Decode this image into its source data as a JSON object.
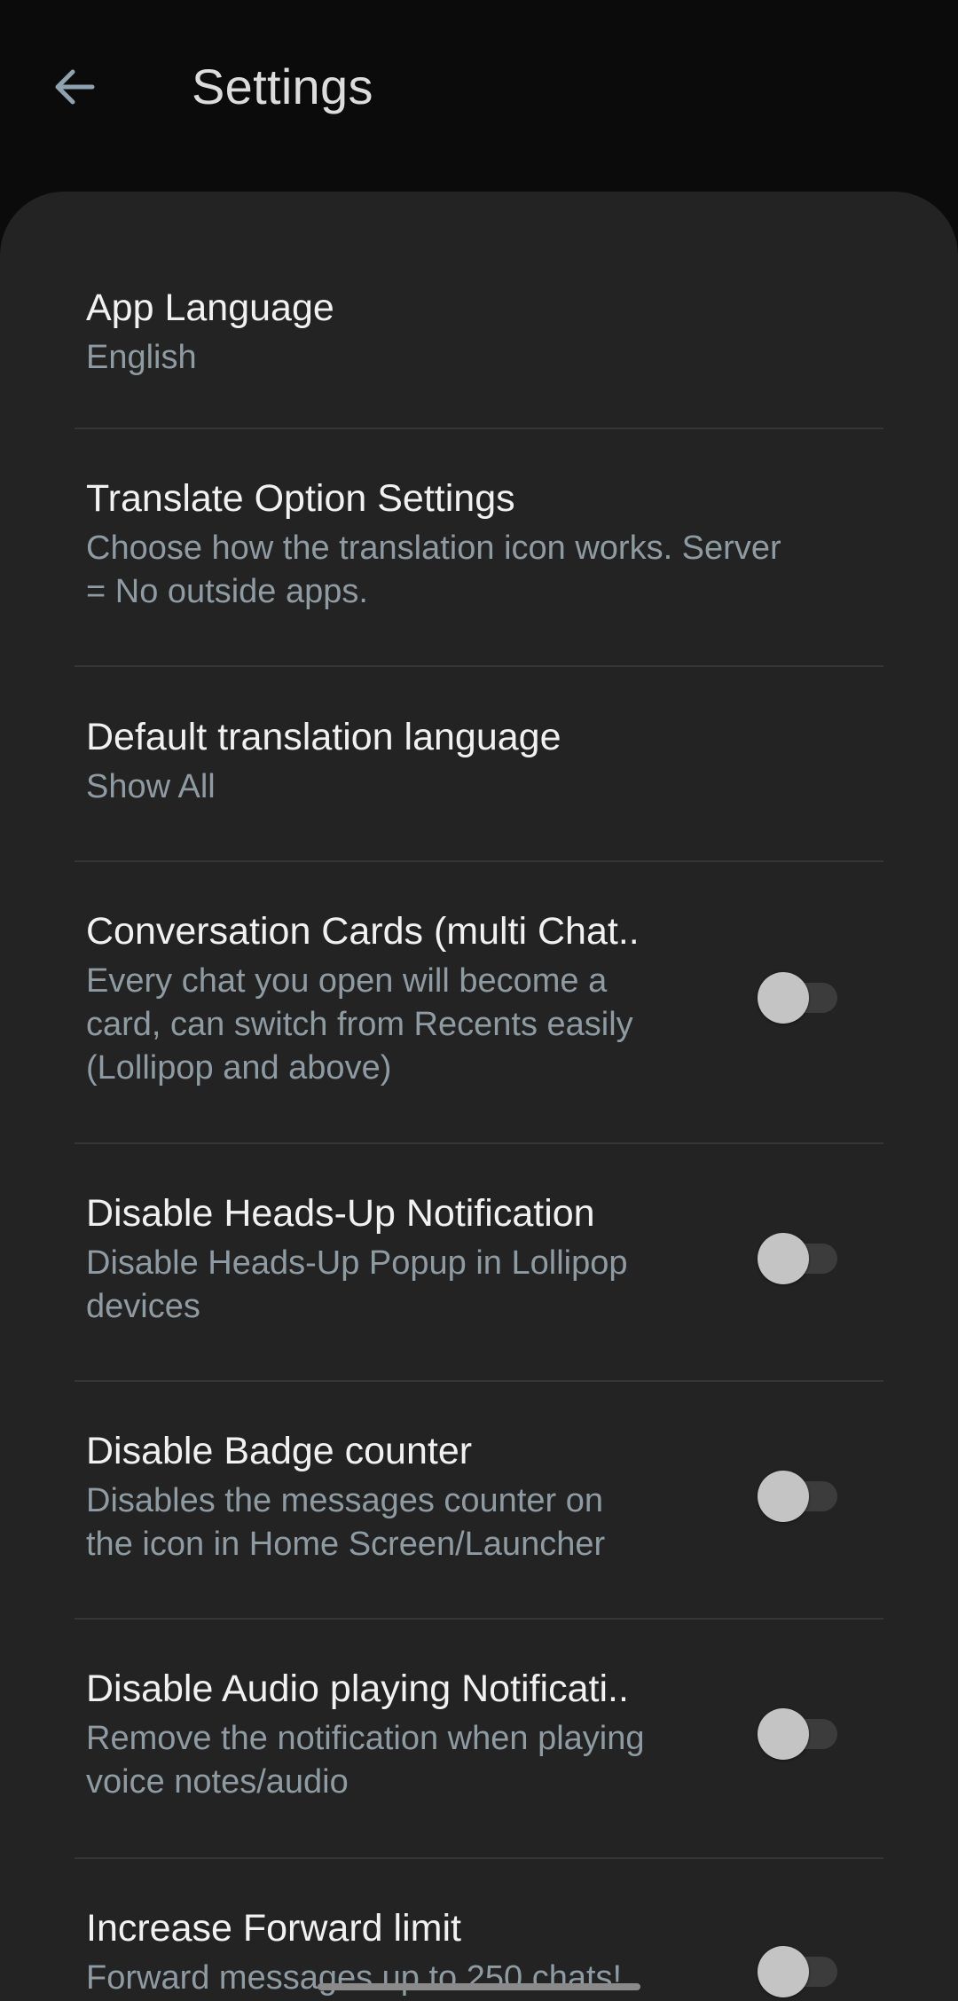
{
  "appbar": {
    "title": "Settings",
    "back_icon": "arrow-left-icon",
    "back_icon_color": "#8fa2b0"
  },
  "colors": {
    "background": "#0b0b0b",
    "sheet": "#232323",
    "title_text": "#f1f1f1",
    "summary_text": "#8f9ba3",
    "divider": "#363636",
    "switch_track_off": "#3c3c3c",
    "switch_thumb_off": "#c4c4c4"
  },
  "settings": [
    {
      "title": "App Language",
      "summary": "English"
    },
    {
      "title": "Translate Option Settings",
      "summary_lines": [
        "Choose how the translation icon works. Server",
        "= No outside apps."
      ]
    },
    {
      "title": "Default translation language",
      "summary": "Show All"
    },
    {
      "title": "Conversation Cards (multi Chat..",
      "summary_lines": [
        "Every chat you open will become a",
        "card, can switch from Recents easily",
        "(Lollipop and above)"
      ],
      "switch_on": false
    },
    {
      "title": "Disable Heads-Up Notification",
      "summary_lines": [
        "Disable Heads-Up Popup in Lollipop",
        "devices"
      ],
      "switch_on": false
    },
    {
      "title": "Disable Badge counter",
      "summary_lines": [
        "Disables the messages counter on",
        "the icon in Home Screen/Launcher"
      ],
      "switch_on": false
    },
    {
      "title": "Disable Audio playing Notificati..",
      "summary_lines": [
        "Remove the notification when playing",
        "voice notes/audio"
      ],
      "switch_on": false
    },
    {
      "title": "Increase Forward limit",
      "summary": "Forward messages up to 250 chats!",
      "switch_on": false
    }
  ]
}
